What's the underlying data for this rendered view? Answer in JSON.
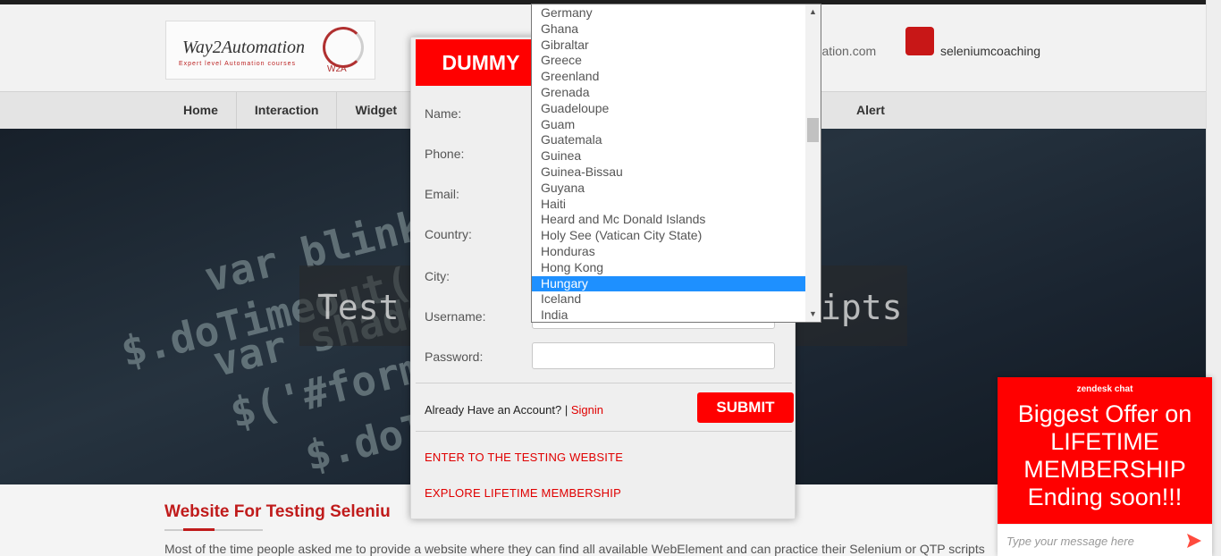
{
  "header": {
    "logo_title": "Way2Automation",
    "logo_subtitle": "Expert level Automation courses",
    "logo_mark": "W2A",
    "contact_email_fragment": "omation.com",
    "skype_label": "seleniumcoaching"
  },
  "nav": {
    "items": [
      "Home",
      "Interaction",
      "Widget"
    ],
    "alert": "Alert"
  },
  "hero": {
    "text_left": "Test",
    "text_right": "ipts",
    "code_snippets": [
      "$.doTimeout('scr",
      "var blinkSpe",
      "var shadowT",
      "$('#form_",
      "$.doTi"
    ]
  },
  "section": {
    "title": "Website For Testing Seleniu",
    "intro": "Most of the time people asked me to provide a website where they can find all available WebElement and can practice their Selenium or QTP scripts"
  },
  "modal": {
    "title": "DUMMY",
    "labels": {
      "name": "Name:",
      "phone": "Phone:",
      "email": "Email:",
      "country": "Country:",
      "city": "City:",
      "username": "Username:",
      "password": "Password:"
    },
    "account_prompt": "Already Have an Account? |",
    "signin": "Signin",
    "submit": "SUBMIT",
    "link_testing": "ENTER TO THE TESTING WEBSITE",
    "link_membership": "EXPLORE LIFETIME MEMBERSHIP"
  },
  "country_dropdown": {
    "options": [
      "Germany",
      "Ghana",
      "Gibraltar",
      "Greece",
      "Greenland",
      "Grenada",
      "Guadeloupe",
      "Guam",
      "Guatemala",
      "Guinea",
      "Guinea-Bissau",
      "Guyana",
      "Haiti",
      "Heard and Mc Donald Islands",
      "Holy See (Vatican City State)",
      "Honduras",
      "Hong Kong",
      "Hungary",
      "Iceland",
      "India"
    ],
    "selected": "Hungary",
    "highlight_color": "#1e90ff"
  },
  "chat": {
    "brand": "zendesk chat",
    "offer": "Biggest Offer on LIFETIME MEMBERSHIP Ending soon!!!",
    "placeholder": "Type your message here",
    "send_icon": "send-arrow-icon"
  },
  "colors": {
    "accent_red": "#ff0000",
    "brand_red": "#c01b1b"
  }
}
